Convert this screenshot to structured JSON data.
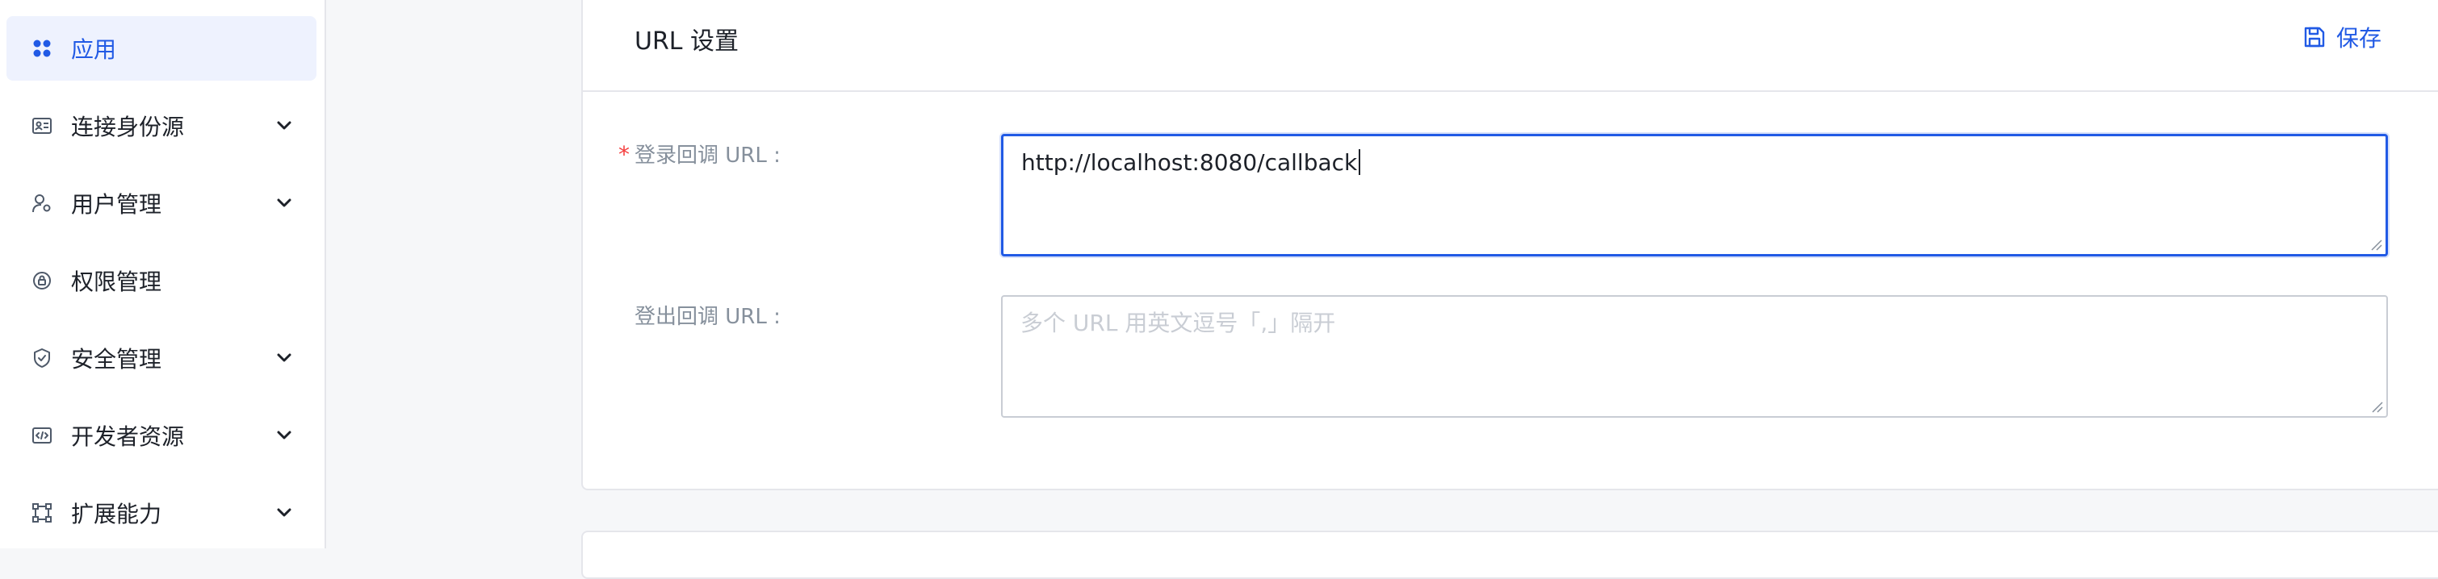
{
  "sidebar": {
    "items": [
      {
        "label": "应用",
        "icon": "apps-icon",
        "active": true,
        "expandable": false
      },
      {
        "label": "连接身份源",
        "icon": "id-card-icon",
        "active": false,
        "expandable": true
      },
      {
        "label": "用户管理",
        "icon": "user-settings-icon",
        "active": false,
        "expandable": true
      },
      {
        "label": "权限管理",
        "icon": "permission-icon",
        "active": false,
        "expandable": false
      },
      {
        "label": "安全管理",
        "icon": "shield-icon",
        "active": false,
        "expandable": true
      },
      {
        "label": "开发者资源",
        "icon": "code-icon",
        "active": false,
        "expandable": true
      },
      {
        "label": "扩展能力",
        "icon": "extension-icon",
        "active": false,
        "expandable": true
      }
    ]
  },
  "card": {
    "title": "URL 设置",
    "save_label": "保存",
    "save_icon": "save-icon",
    "fields": {
      "login_callback": {
        "label": "登录回调 URL :",
        "required": true,
        "value": "http://localhost:8080/callback",
        "placeholder": ""
      },
      "logout_callback": {
        "label": "登出回调 URL :",
        "required": false,
        "value": "",
        "placeholder": "多个 URL 用英文逗号「,」隔开"
      }
    }
  },
  "colors": {
    "accent": "#215ae5",
    "active_bg": "#eef2fe",
    "required": "#f53f3f",
    "label_gray": "#86909c",
    "border": "#e5e6eb",
    "page_bg": "#f6f7f9"
  }
}
